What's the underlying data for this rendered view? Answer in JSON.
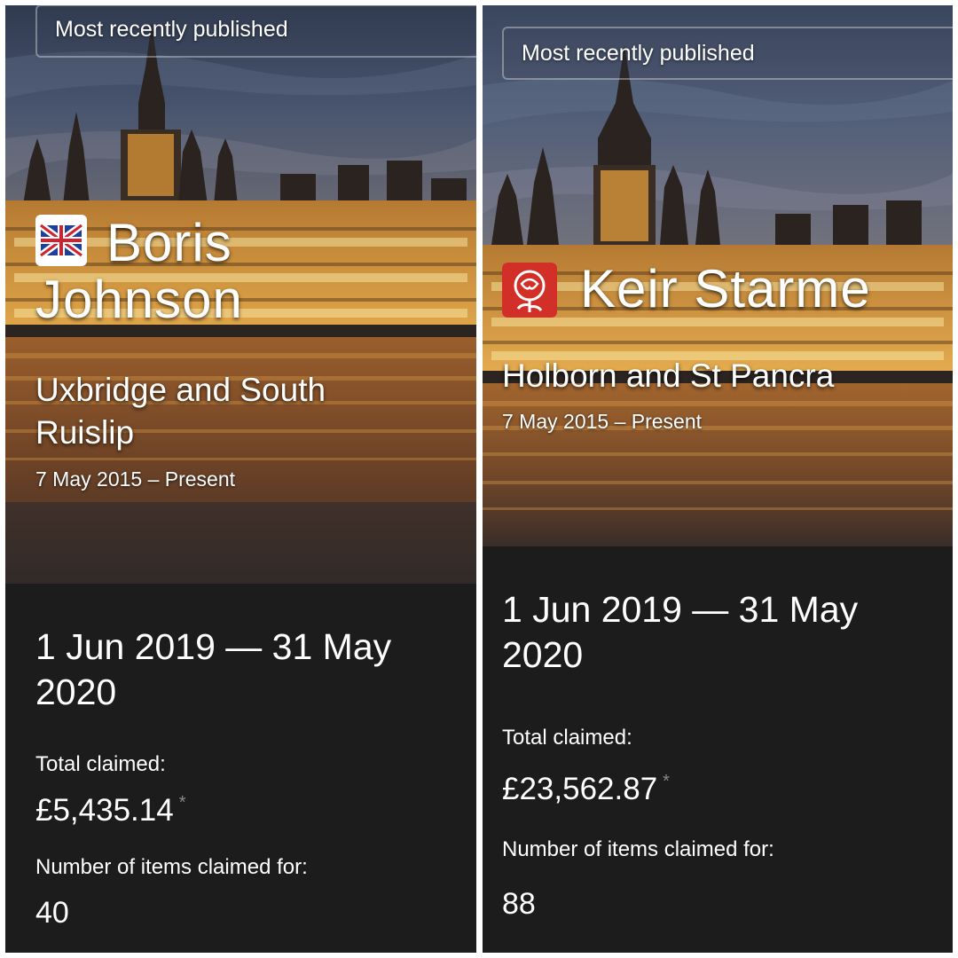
{
  "colors": {
    "panel_bg": "#1c1c1c",
    "text": "#ffffff",
    "asterisk": "#8a8a8a",
    "sky_top": "#39475f",
    "river": "#8a5530",
    "building_lights": "#d59a3a",
    "labour_red": "#d12f27"
  },
  "left": {
    "chip_label": "Most recently published",
    "party_icon": "union-jack-icon",
    "name_line1": "Boris",
    "name_line2": "Johnson",
    "constituency_line1": "Uxbridge and South",
    "constituency_line2": "Ruislip",
    "tenure": "7 May 2015 – Present",
    "period_line1": "1 Jun 2019 — 31 May",
    "period_line2": "2020",
    "total_label": "Total claimed:",
    "total_value": "£5,435.14",
    "asterisk": "*",
    "items_label": "Number of items claimed for:",
    "items_value": "40"
  },
  "right": {
    "chip_label": "Most recently published",
    "party_icon": "labour-rose-icon",
    "name_line1": "Keir Starme",
    "constituency_line1": "Holborn and St Pancra",
    "tenure": "7 May 2015 – Present",
    "period_line1": "1 Jun 2019 — 31 May",
    "period_line2": "2020",
    "total_label": "Total claimed:",
    "total_value": "£23,562.87",
    "asterisk": "*",
    "items_label": "Number of items claimed for:",
    "items_value": "88"
  }
}
